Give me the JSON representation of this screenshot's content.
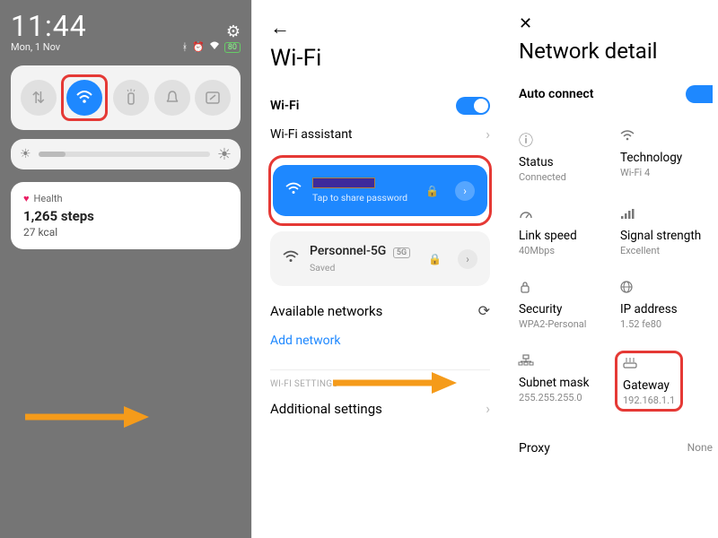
{
  "panel1": {
    "clock": "11:44",
    "date": "Mon, 1 Nov",
    "battery": "80",
    "brightness_pct": 16,
    "health": {
      "title": "Health",
      "steps": "1,265 steps",
      "kcal": "27 kcal"
    }
  },
  "panel2": {
    "title": "Wi-Fi",
    "wifi_label": "Wi-Fi",
    "wifi_on": true,
    "assistant_label": "Wi-Fi assistant",
    "connected": {
      "share_hint": "Tap to share password"
    },
    "saved_network": {
      "name": "Personnel-5G",
      "badge": "5G",
      "sub": "Saved"
    },
    "available_label": "Available networks",
    "add_network_label": "Add network",
    "settings_section": "WI-FI SETTINGS",
    "additional_label": "Additional settings"
  },
  "panel3": {
    "title": "Network detail",
    "auto_connect_label": "Auto connect",
    "tiles": {
      "status": {
        "label": "Status",
        "value": "Connected"
      },
      "technology": {
        "label": "Technology",
        "value": "Wi-Fi 4"
      },
      "link_speed": {
        "label": "Link speed",
        "value": "40Mbps"
      },
      "signal": {
        "label": "Signal strength",
        "value": "Excellent"
      },
      "security": {
        "label": "Security",
        "value": "WPA2-Personal"
      },
      "ip": {
        "label": "IP address",
        "value": "1.52 fe80"
      },
      "subnet": {
        "label": "Subnet mask",
        "value": "255.255.255.0"
      },
      "gateway": {
        "label": "Gateway",
        "value": "192.168.1.1"
      }
    },
    "proxy_label": "Proxy",
    "proxy_value": "None"
  }
}
